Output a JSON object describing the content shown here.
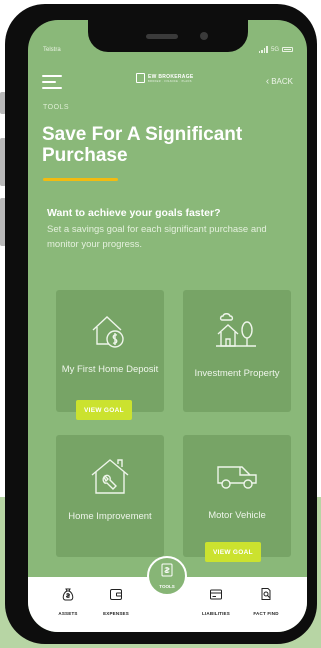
{
  "status_bar": {
    "carrier": "Telstra",
    "network": "5G"
  },
  "header": {
    "logo_title": "EW BROKERAGE",
    "logo_subtitle": "BROKER · FINANCE · PLANS",
    "back_label": "BACK"
  },
  "page": {
    "eyebrow": "TOOLS",
    "title": "Save For A Significant Purchase",
    "intro_heading": "Want to achieve your goals faster?",
    "intro_body": "Set a savings goal for each significant purchase and monitor your progress."
  },
  "goals": [
    {
      "label": "My First Home Deposit",
      "icon": "house-money-icon",
      "button": "VIEW GOAL"
    },
    {
      "label": "Investment Property",
      "icon": "house-tree-cloud-icon"
    },
    {
      "label": "Home Improvement",
      "icon": "house-wrench-icon"
    },
    {
      "label": "Motor Vehicle",
      "icon": "car-icon",
      "button": "VIEW GOAL"
    }
  ],
  "bottom_nav": {
    "items": [
      {
        "label": "ASSETS",
        "icon": "money-bag-icon"
      },
      {
        "label": "EXPENSES",
        "icon": "wallet-icon"
      },
      {
        "label": "TOOLS",
        "icon": "tools-icon"
      },
      {
        "label": "LIABILITIES",
        "icon": "card-icon"
      },
      {
        "label": "FACT FIND",
        "icon": "document-search-icon"
      }
    ]
  },
  "colors": {
    "screen_bg": "#8ab879",
    "card_bg": "#77a466",
    "accent_yellow": "#f3bb10",
    "goal_button": "#cbe22f"
  }
}
